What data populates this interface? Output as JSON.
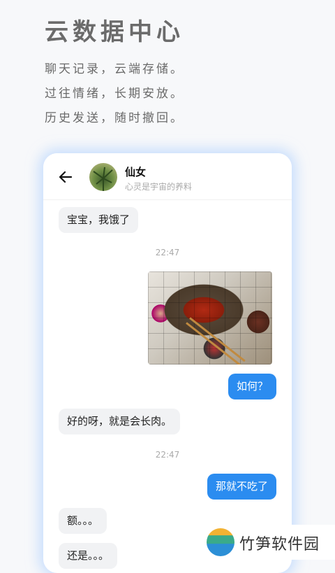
{
  "promo": {
    "headline": "云数据中心",
    "lines": [
      "聊天记录，云端存储。",
      "过往情绪，长期安放。",
      "历史发送，随时撤回。"
    ]
  },
  "chat": {
    "contact_name": "仙女",
    "contact_status": "心灵是宇宙的养料",
    "messages": [
      {
        "side": "in",
        "text": "宝宝，我饿了"
      },
      {
        "type": "time",
        "text": "22:47"
      },
      {
        "side": "out",
        "type": "image",
        "alt": "food-photo"
      },
      {
        "side": "out",
        "text": "如何？"
      },
      {
        "side": "in",
        "text": "好的呀，就是会长肉。"
      },
      {
        "type": "time",
        "text": "22:47"
      },
      {
        "side": "out",
        "text": "那就不吃了"
      },
      {
        "side": "in",
        "text": "额。。。"
      },
      {
        "side": "in",
        "text": "还是。。。"
      }
    ]
  },
  "watermark": {
    "text": "竹笋软件园"
  }
}
